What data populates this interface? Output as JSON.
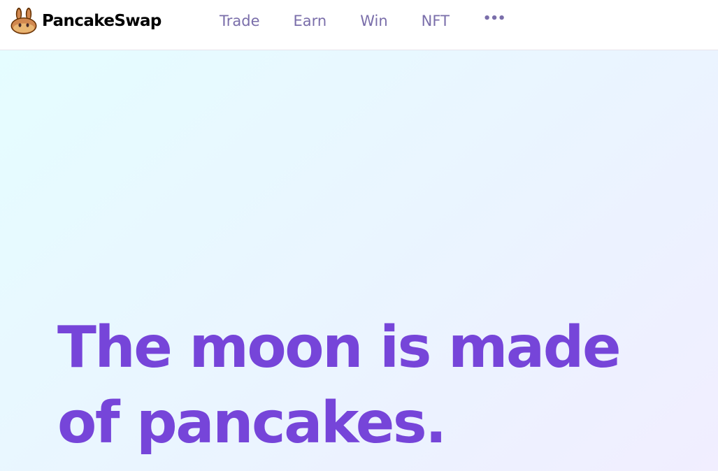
{
  "brand": {
    "name": "PancakeSwap",
    "logo_icon": "pancake-bunny-icon"
  },
  "nav": {
    "items": [
      {
        "label": "Trade"
      },
      {
        "label": "Earn"
      },
      {
        "label": "Win"
      },
      {
        "label": "NFT"
      }
    ],
    "more_label": "•••",
    "more_icon": "more-dots-icon"
  },
  "hero": {
    "title": "The moon is made of pancakes."
  },
  "colors": {
    "brand_text": "#000000",
    "nav_text": "#7A6EAA",
    "hero_text": "#7645D9",
    "hero_bg_start": "#E5FDFF",
    "hero_bg_end": "#F1EEFF",
    "bunny_brown": "#D1884F",
    "bunny_dark": "#633001"
  }
}
